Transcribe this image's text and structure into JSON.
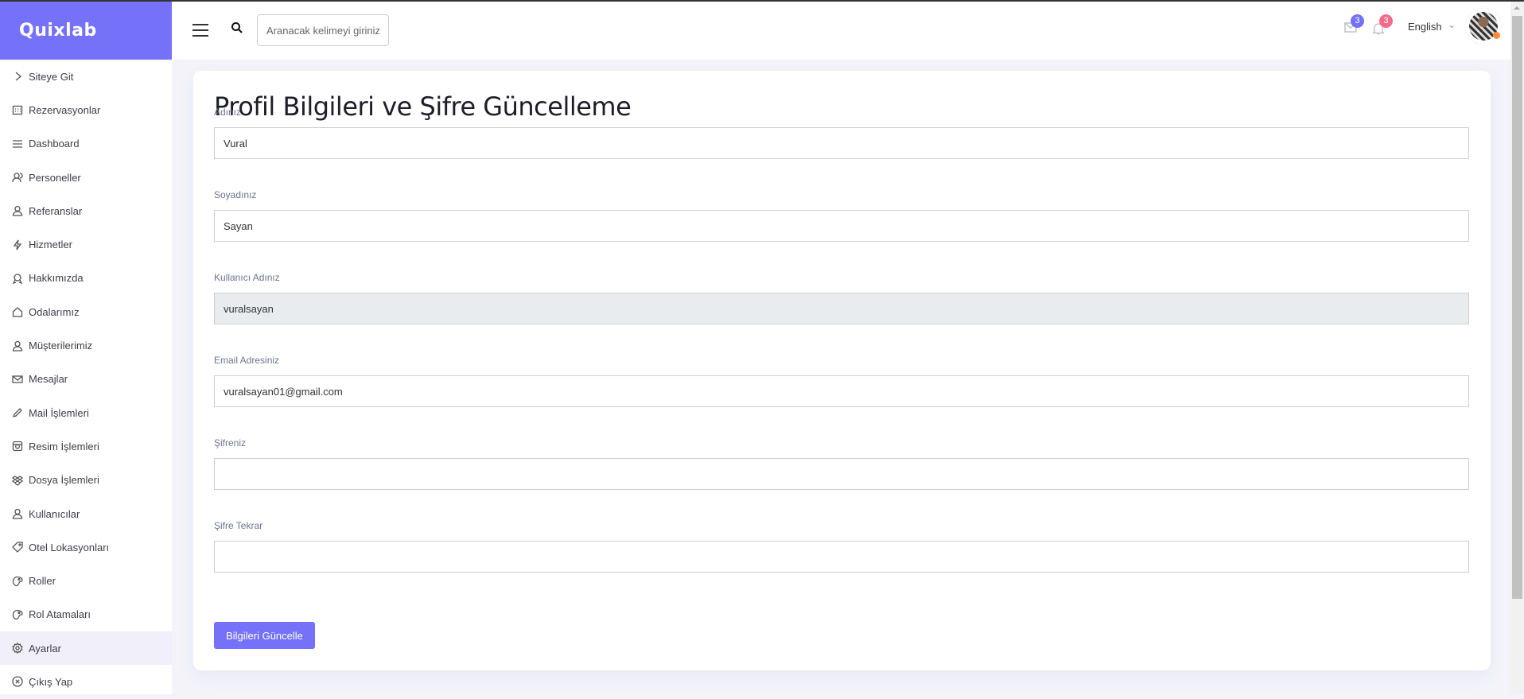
{
  "brand": "Quixlab",
  "header": {
    "search_placeholder": "Aranacak kelimeyi giriniz",
    "mail_count": "3",
    "notif_count": "3",
    "language": "English",
    "mail_badge_color": "#7571f9",
    "notif_badge_color": "#f76b8a"
  },
  "sidebar": {
    "items": [
      {
        "label": "Siteye Git",
        "icon": "chevron-right-icon"
      },
      {
        "label": "Rezervasyonlar",
        "icon": "calendar-icon"
      },
      {
        "label": "Dashboard",
        "icon": "menu-icon"
      },
      {
        "label": "Personeller",
        "icon": "users-icon"
      },
      {
        "label": "Referanslar",
        "icon": "user-icon"
      },
      {
        "label": "Hizmetler",
        "icon": "bolt-icon"
      },
      {
        "label": "Hakkımızda",
        "icon": "badge-icon"
      },
      {
        "label": "Odalarımız",
        "icon": "home-icon"
      },
      {
        "label": "Müşterilerimiz",
        "icon": "user-icon"
      },
      {
        "label": "Mesajlar",
        "icon": "envelope-icon"
      },
      {
        "label": "Mail İşlemleri",
        "icon": "pencil-icon"
      },
      {
        "label": "Resim İşlemleri",
        "icon": "image-icon"
      },
      {
        "label": "Dosya İşlemleri",
        "icon": "dropbox-icon"
      },
      {
        "label": "Kullanıcılar",
        "icon": "user-icon"
      },
      {
        "label": "Otel Lokasyonları",
        "icon": "tag-icon"
      },
      {
        "label": "Roller",
        "icon": "palette-icon"
      },
      {
        "label": "Rol Atamaları",
        "icon": "palette-icon"
      },
      {
        "label": "Ayarlar",
        "icon": "gear-icon",
        "active": true
      },
      {
        "label": "Çıkış Yap",
        "icon": "close-circle-icon"
      }
    ]
  },
  "form": {
    "title": "Profil Bilgileri ve Şifre Güncelleme",
    "fields": [
      {
        "label": "Adınız",
        "value": "Vural"
      },
      {
        "label": "Soyadınız",
        "value": "Sayan"
      },
      {
        "label": "Kullanıcı Adınız",
        "value": "vuralsayan",
        "readonly": true
      },
      {
        "label": "Email Adresiniz",
        "value": "vuralsayan01@gmail.com"
      },
      {
        "label": "Şifreniz",
        "value": ""
      },
      {
        "label": "Şifre Tekrar",
        "value": ""
      }
    ],
    "submit_label": "Bilgileri Güncelle"
  }
}
